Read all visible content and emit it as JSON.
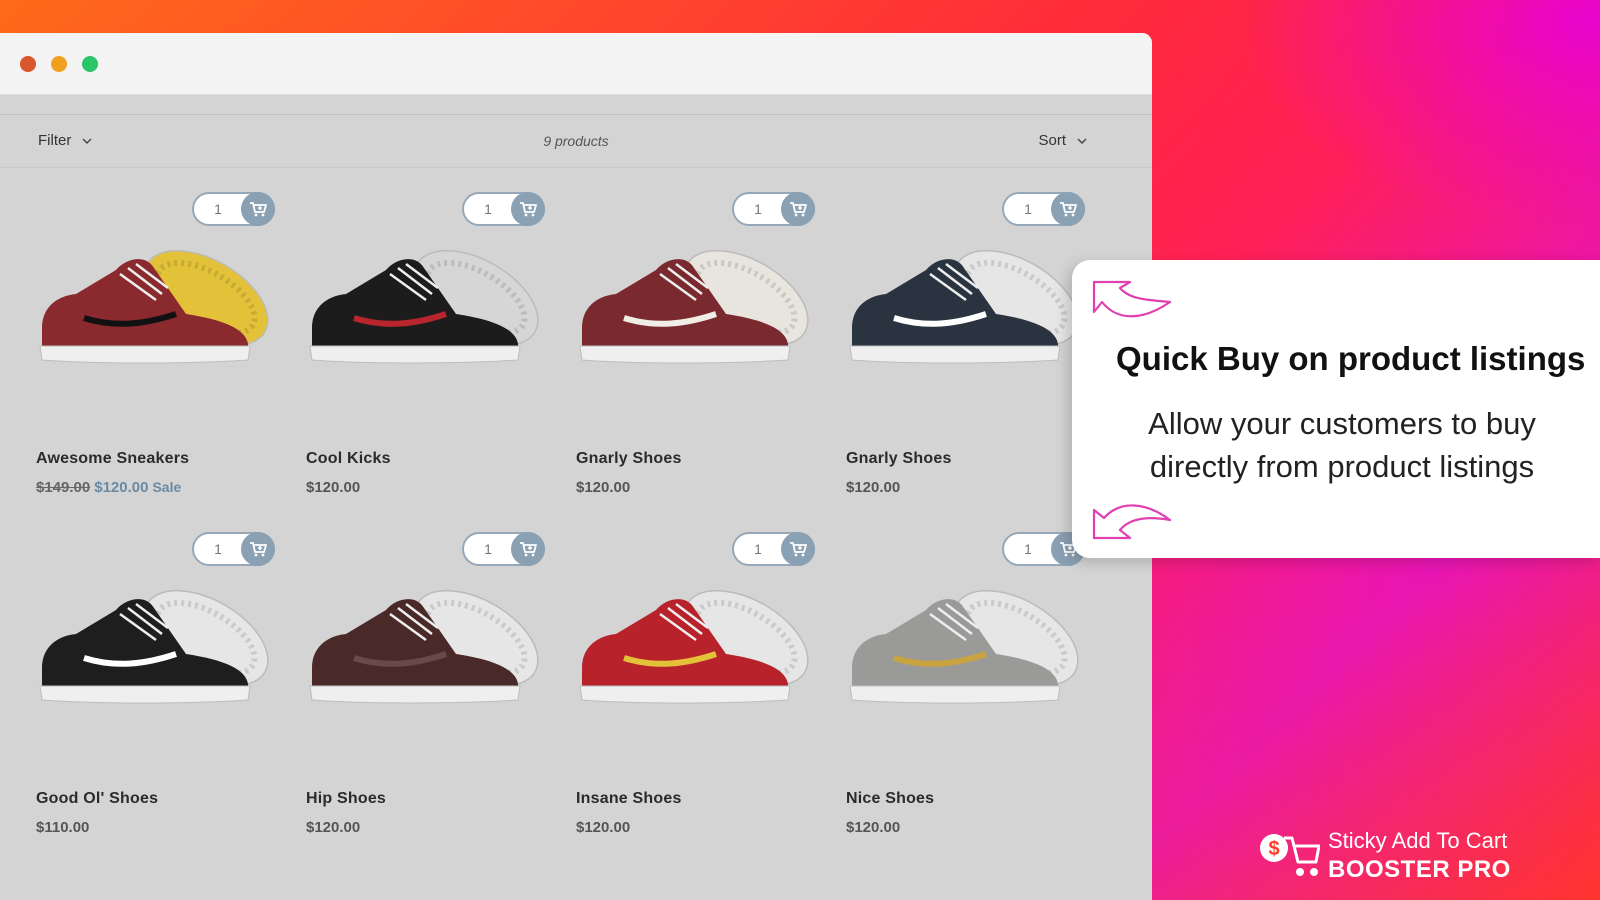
{
  "window": {
    "traffic_lights": [
      "close",
      "minimize",
      "maximize"
    ]
  },
  "toolbar": {
    "filter_label": "Filter",
    "product_count": "9 products",
    "sort_label": "Sort"
  },
  "products": [
    {
      "name": "Awesome Sneakers",
      "price_old": "$149.00",
      "price": "$120.00",
      "badge": "Sale",
      "qty": "1"
    },
    {
      "name": "Cool Kicks",
      "price": "$120.00",
      "qty": "1"
    },
    {
      "name": "Gnarly Shoes",
      "price": "$120.00",
      "qty": "1"
    },
    {
      "name": "Gnarly Shoes",
      "price": "$120.00",
      "qty": "1"
    },
    {
      "name": "Good Ol' Shoes",
      "price": "$110.00",
      "qty": "1"
    },
    {
      "name": "Hip Shoes",
      "price": "$120.00",
      "qty": "1"
    },
    {
      "name": "Insane Shoes",
      "price": "$120.00",
      "qty": "1"
    },
    {
      "name": "Nice Shoes",
      "price": "$120.00",
      "qty": "1"
    }
  ],
  "callout": {
    "title": "Quick Buy on product listings",
    "body": "Allow your customers to buy directly from product listings"
  },
  "brand": {
    "line1": "Sticky Add To Cart",
    "line2": "BOOSTER PRO"
  },
  "colors": {
    "cart_button": "#8aa0b3",
    "sale_price": "#6a8aa3",
    "arrow": "#e040b0",
    "dot_close": "#d9572c",
    "dot_minimize": "#f0a01d",
    "dot_maximize": "#2bc46a"
  },
  "icons": {
    "cart": "cart-plus-icon",
    "chevron": "chevron-down-icon",
    "arrow": "curved-arrow-icon"
  }
}
